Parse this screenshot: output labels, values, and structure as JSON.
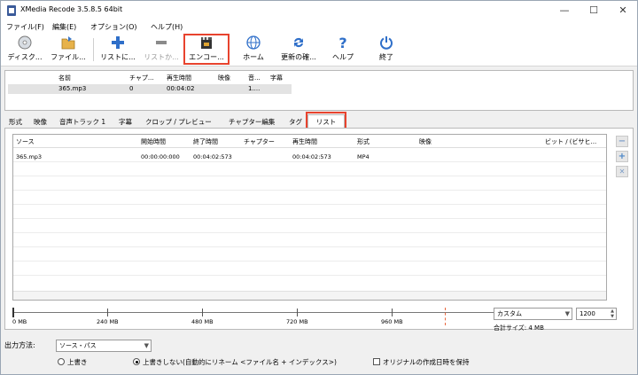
{
  "window": {
    "title": "XMedia Recode 3.5.8.5 64bit",
    "minimize": "—",
    "maximize": "☐",
    "close": "✕"
  },
  "menu": [
    "ファイル(F)",
    "編集(E)",
    "オプション(O)",
    "ヘルプ(H)"
  ],
  "toolbar": {
    "disk": "ディスク...",
    "file": "ファイル...",
    "add_list": "リストに...",
    "remove_list": "リストか...",
    "encode": "エンコー...",
    "home": "ホーム",
    "update": "更新の確...",
    "help": "ヘルプ",
    "exit": "終了"
  },
  "source_table": {
    "headers": [
      "名前",
      "チャプ...",
      "再生時間",
      "映像",
      "音...",
      "字幕"
    ],
    "row": [
      "365.mp3",
      "0",
      "00:04:02",
      "",
      "1....",
      ""
    ]
  },
  "tabs": [
    "形式",
    "映像",
    "音声トラック 1",
    "字幕",
    "クロップ / プレビュー",
    "チャプター編集",
    "タグ",
    "リスト"
  ],
  "list_table": {
    "headers": [
      "ソース",
      "開始時間",
      "終了時間",
      "チャプター",
      "再生時間",
      "形式",
      "映像",
      "ビット / (ビサヒ..."
    ],
    "row": [
      "365.mp3",
      "00:00:00:000",
      "00:04:02:573",
      "",
      "00:04:02:573",
      "MP4",
      "",
      ""
    ]
  },
  "side_buttons": [
    "−",
    "+",
    "✕"
  ],
  "size_bar": {
    "ticks": [
      "0 MB",
      "240 MB",
      "480 MB",
      "720 MB",
      "960 MB"
    ],
    "preset": "カスタム",
    "value": "1200",
    "total_label": "合計サイズ: 4 MB"
  },
  "output": {
    "label": "出力方法:",
    "mode": "ソース・パス",
    "overwrite": "上書き",
    "no_overwrite": "上書きしない(自動的にリネーム <ファイル名 + インデックス>)",
    "keep_date": "オリジナルの作成日時を保持"
  },
  "colors": {
    "highlight": "#e8432e",
    "accent": "#2f6fc9"
  }
}
